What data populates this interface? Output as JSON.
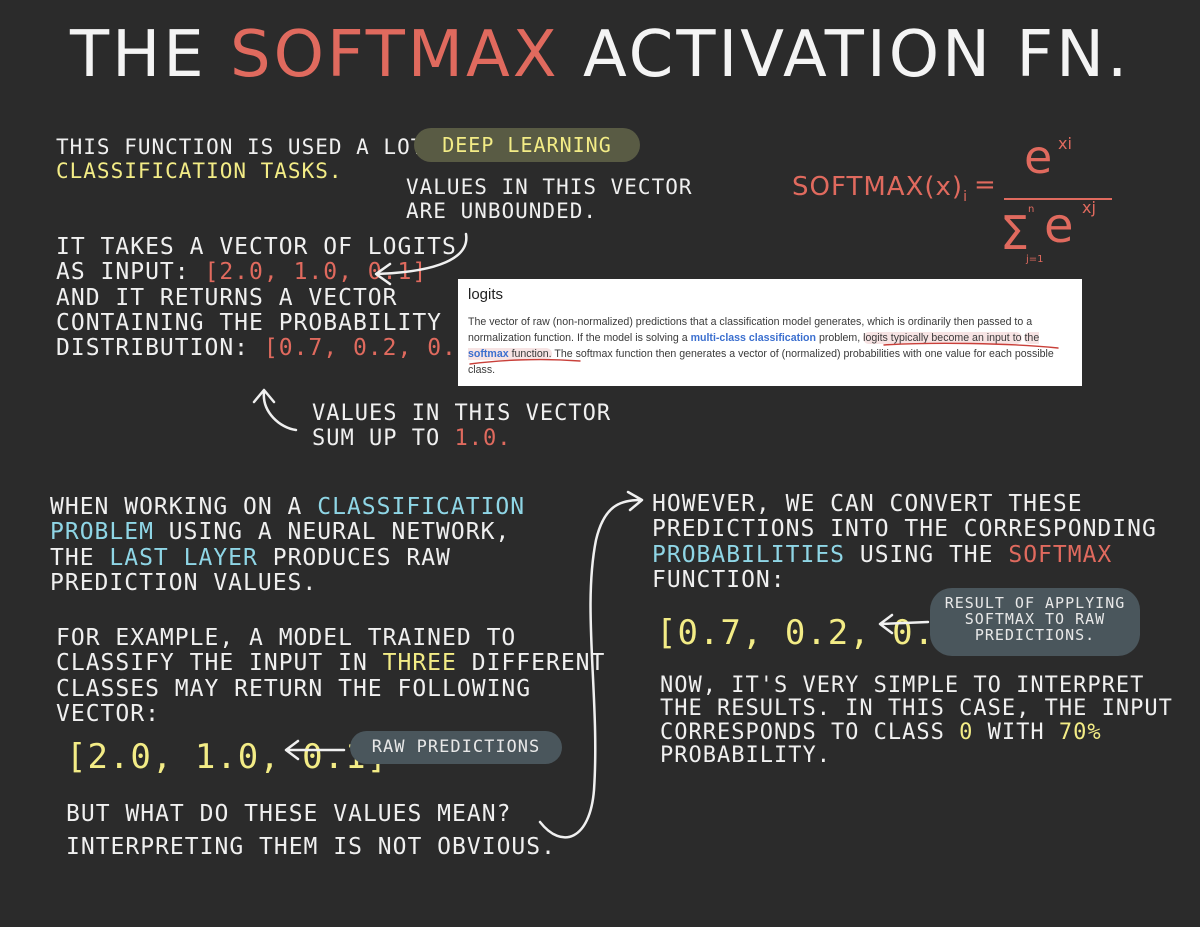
{
  "title": {
    "prefix": "THE ",
    "highlight": "SOFTMAX",
    "suffix": " ACTIVATION FN."
  },
  "intro": {
    "line1": "THIS FUNCTION IS USED A LOT IN",
    "pill": "DEEP LEARNING",
    "line2": "CLASSIFICATION TASKS."
  },
  "unbounded_note": {
    "line1": "VALUES IN THIS VECTOR",
    "line2": "ARE UNBOUNDED."
  },
  "input_desc": {
    "line1": "IT TAKES A VECTOR OF LOGITS",
    "line2_prefix": "AS INPUT:",
    "line2_vector": "[2.0, 1.0, 0.1]",
    "line3": "AND IT RETURNS A VECTOR",
    "line4": "CONTAINING THE PROBABILITY",
    "line5_prefix": "DISTRIBUTION:",
    "line5_vector": "[0.7, 0.2, 0.1]"
  },
  "sum_note": {
    "line1": "VALUES IN THIS VECTOR",
    "line2_prefix": "SUM UP TO",
    "line2_value": "1.0."
  },
  "formula": {
    "lhs": "SOFTMAX(x)",
    "lhs_sub": "i",
    "eq": "=",
    "num": "e",
    "num_sup": "xi",
    "den_sigma": "Σ",
    "den_sigma_top": "n",
    "den_sigma_bottom": "j=1",
    "den_e": "e",
    "den_sup": "xj"
  },
  "definition_card": {
    "title": "logits",
    "text1": "The vector of raw (non-normalized) predictions that a classification model generates, which is ordinarily then passed to a normalization function. If the model is solving a ",
    "link1": "multi-class classification",
    "text2": " problem, ",
    "highlight1": "logits typically become an input to",
    "highlight2_prefix": "the ",
    "link2": "softmax",
    "highlight2_suffix": " function.",
    "text3": " The softmax function then generates a vector of (normalized) probabilities with one value for each possible class."
  },
  "left_block": {
    "p1_l1a": "WHEN WORKING ON A ",
    "p1_l1b": "CLASSIFICATION",
    "p1_l2a": "PROBLEM",
    "p1_l2b": " USING A NEURAL NETWORK,",
    "p1_l3a": "THE ",
    "p1_l3b": "LAST LAYER",
    "p1_l3c": " PRODUCES RAW",
    "p1_l4": "PREDICTION VALUES.",
    "p2_l1": "FOR EXAMPLE, A MODEL TRAINED TO",
    "p2_l2a": "CLASSIFY THE INPUT IN ",
    "p2_l2b": "THREE",
    "p2_l2c": " DIFFERENT",
    "p2_l3": "CLASSES MAY RETURN THE FOLLOWING",
    "p2_l4": "VECTOR:",
    "vector": "[2.0, 1.0, 0.1]",
    "pill": "RAW PREDICTIONS",
    "p3_l1": "BUT WHAT DO THESE VALUES MEAN?",
    "p3_l2": "INTERPRETING THEM IS NOT OBVIOUS."
  },
  "right_block": {
    "l1": "HOWEVER, WE CAN CONVERT THESE",
    "l2": "PREDICTIONS INTO THE CORRESPONDING",
    "l3a": "PROBABILITIES",
    "l3b": " USING THE ",
    "l3c": "SOFTMAX",
    "l4": "FUNCTION:",
    "vector": "[0.7, 0.2, 0.1]",
    "pill_l1": "RESULT OF APPLYING",
    "pill_l2": "SOFTMAX TO RAW",
    "pill_l3": "PREDICTIONS.",
    "c_l1": "NOW, IT'S VERY SIMPLE TO INTERPRET",
    "c_l2": "THE RESULTS. IN THIS CASE, THE INPUT",
    "c_l3a": "CORRESPONDS TO CLASS ",
    "c_l3b": "0",
    "c_l3c": " WITH ",
    "c_l3d": "70%",
    "c_l4": "PROBABILITY."
  },
  "colors": {
    "background": "#2b2b2b",
    "red": "#e06a5e",
    "yellow": "#f3ec86",
    "blue": "#8fd6e6",
    "pill_olive": "#595b44",
    "pill_slate": "#4a565c"
  }
}
